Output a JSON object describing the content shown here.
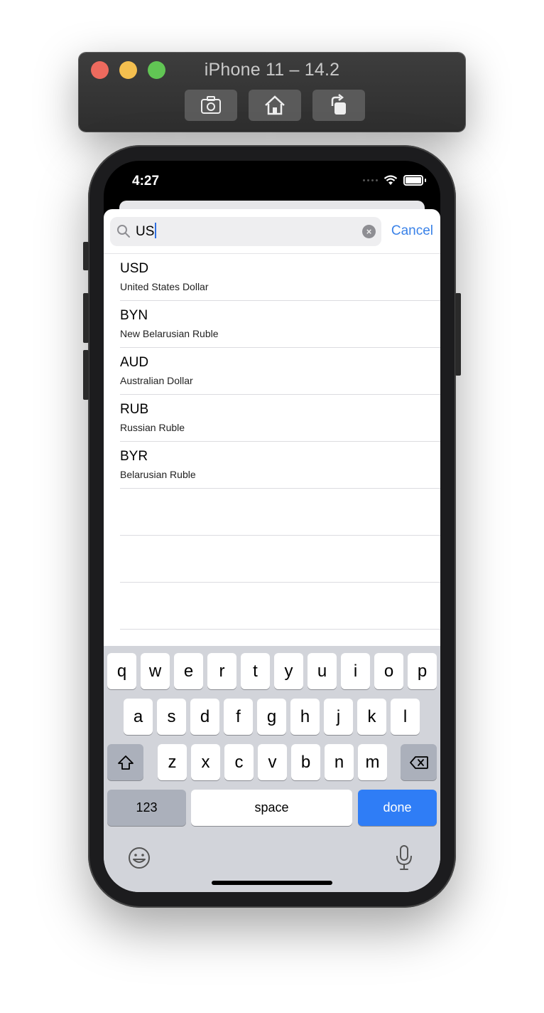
{
  "window": {
    "title": "iPhone 11 – 14.2"
  },
  "status_bar": {
    "time": "4:27"
  },
  "search": {
    "value": "US",
    "cancel_label": "Cancel"
  },
  "results": [
    {
      "code": "USD",
      "name": "United States Dollar"
    },
    {
      "code": "BYN",
      "name": "New Belarusian Ruble"
    },
    {
      "code": "AUD",
      "name": "Australian Dollar"
    },
    {
      "code": "RUB",
      "name": "Russian Ruble"
    },
    {
      "code": "BYR",
      "name": "Belarusian Ruble"
    }
  ],
  "keyboard": {
    "row1": [
      "q",
      "w",
      "e",
      "r",
      "t",
      "y",
      "u",
      "i",
      "o",
      "p"
    ],
    "row2": [
      "a",
      "s",
      "d",
      "f",
      "g",
      "h",
      "j",
      "k",
      "l"
    ],
    "row3": [
      "z",
      "x",
      "c",
      "v",
      "b",
      "n",
      "m"
    ],
    "numbers_label": "123",
    "space_label": "space",
    "done_label": "done"
  },
  "colors": {
    "accent": "#3a82e8",
    "done_key": "#2f7df6"
  }
}
